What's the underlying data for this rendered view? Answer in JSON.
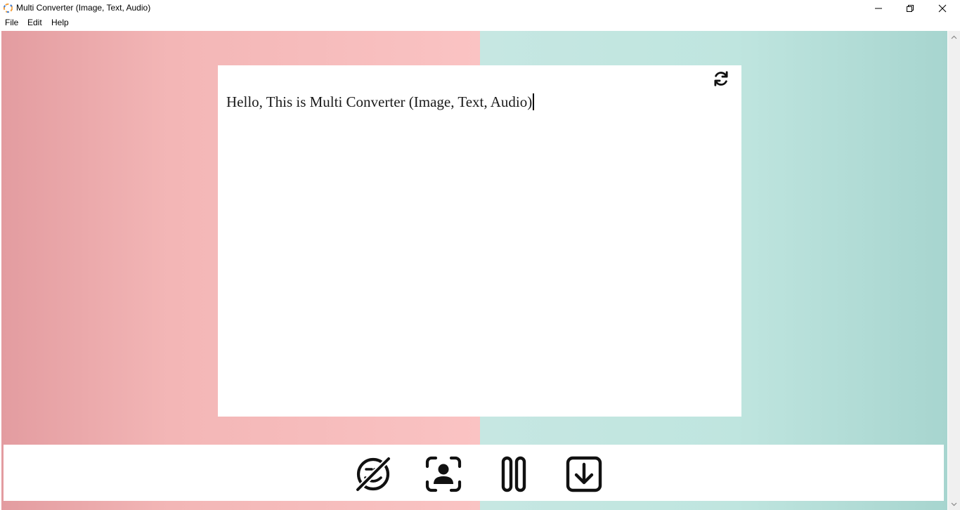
{
  "window": {
    "title": "Multi Converter (Image, Text, Audio)"
  },
  "menu": {
    "items": [
      {
        "label": "File"
      },
      {
        "label": "Edit"
      },
      {
        "label": "Help"
      }
    ]
  },
  "editor": {
    "text": "Hello, This is Multi Converter (Image, Text, Audio)"
  },
  "toolbar": {
    "buttons": [
      {
        "icon": "no-emoji-icon"
      },
      {
        "icon": "user-scan-icon"
      },
      {
        "icon": "pause-icon"
      },
      {
        "icon": "download-icon"
      }
    ],
    "refresh_icon": "refresh-icon"
  },
  "colors": {
    "left_bg": "#f3b6b6",
    "right_bg": "#bfe5df",
    "icon": "#111111"
  }
}
